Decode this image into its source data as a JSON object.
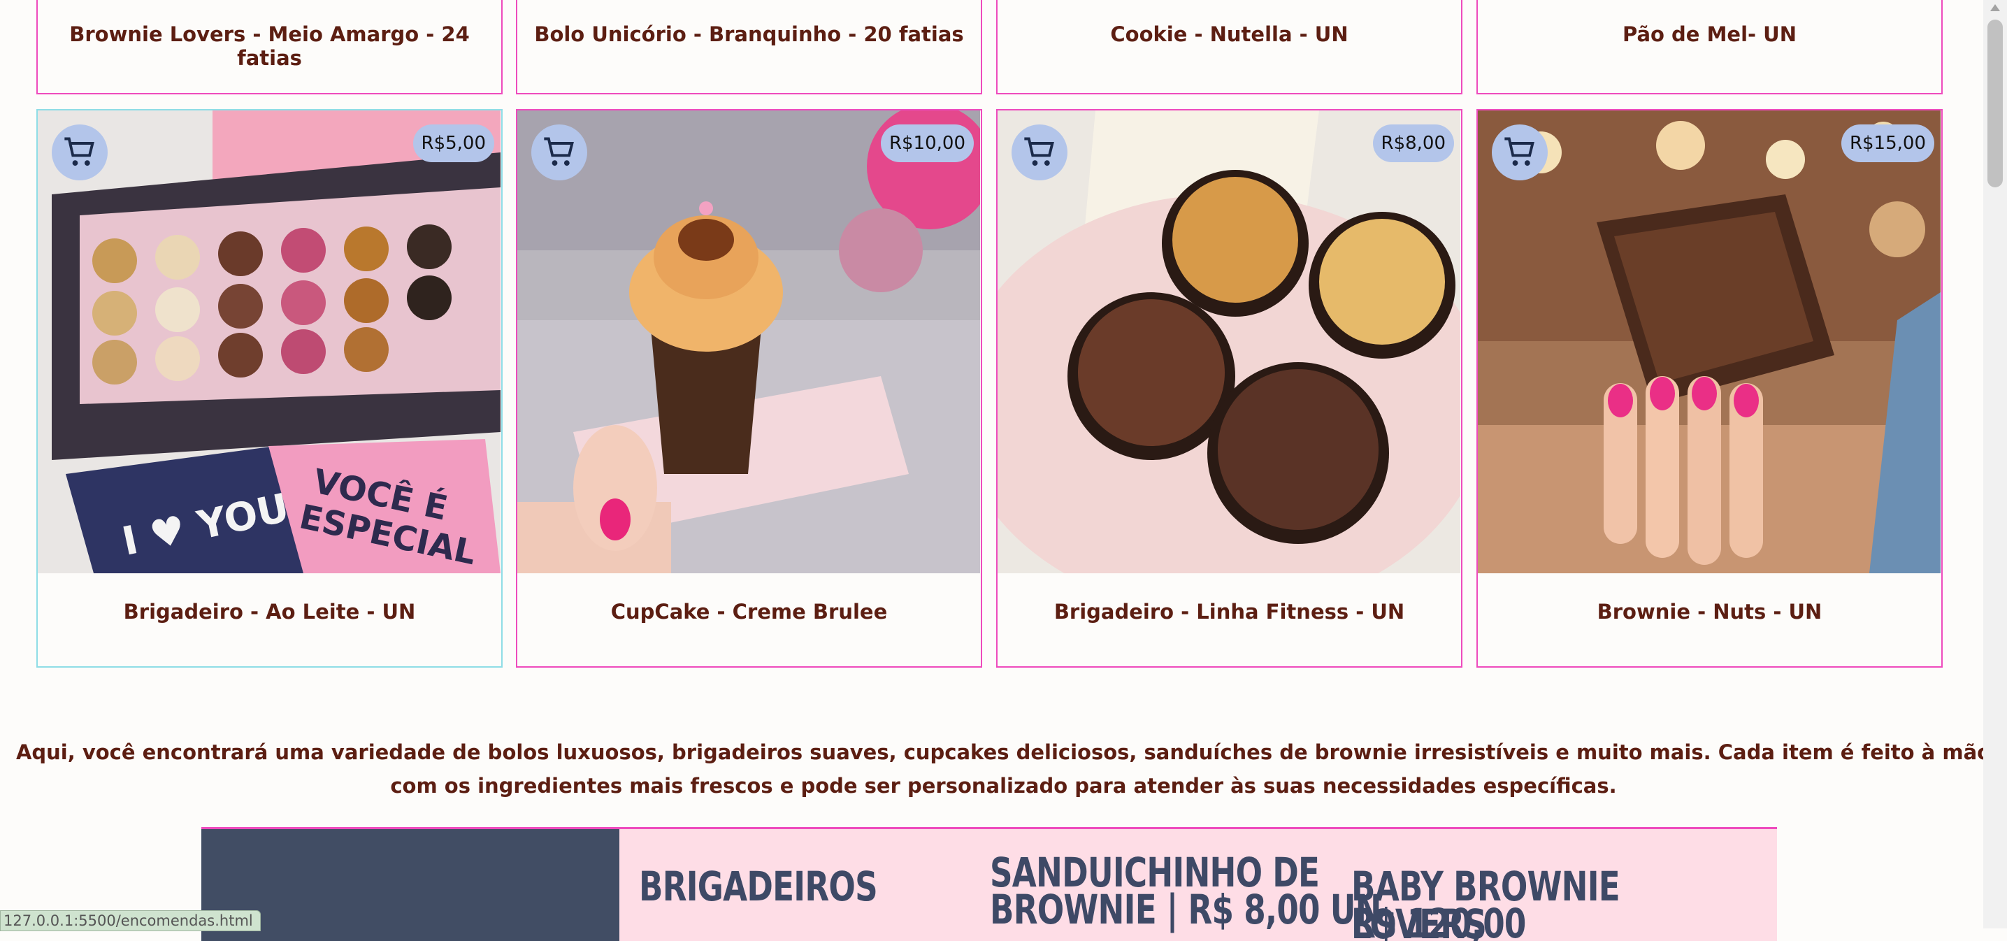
{
  "top_row": [
    {
      "name": "Brownie Lovers - Meio Amargo - 24 fatias"
    },
    {
      "name": "Bolo Unicório - Branquinho - 20 fatias"
    },
    {
      "name": "Cookie - Nutella - UN"
    },
    {
      "name": "Pão de Mel- UN"
    }
  ],
  "products": [
    {
      "name": "Brigadeiro - Ao Leite - UN",
      "price": "R$5,00",
      "cart_icon": "cart-icon"
    },
    {
      "name": "CupCake - Creme Brulee",
      "price": "R$10,00",
      "cart_icon": "cart-icon"
    },
    {
      "name": "Brigadeiro - Linha Fitness - UN",
      "price": "R$8,00",
      "cart_icon": "cart-icon"
    },
    {
      "name": "Brownie - Nuts - UN",
      "price": "R$15,00",
      "cart_icon": "cart-icon"
    }
  ],
  "description": "Aqui, você encontrará uma variedade de bolos luxuosos, brigadeiros suaves, cupcakes deliciosos, sanduíches de brownie irresistíveis e muito mais. Cada item é feito à mão com os ingredientes mais frescos e pode ser personalizado para atender às suas necessidades específicas.",
  "banner": {
    "categories": [
      "BRIGADEIROS",
      "SANDUICHINHO DE",
      "BROWNIE | R$ 8,00 UN",
      "BABY BROWNIE LOVERS",
      "R$ 120,00"
    ]
  },
  "status_bar": "127.0.0.1:5500/encomendas.html",
  "colors": {
    "accent_border": "#ee4bbd",
    "text": "#5c1e12",
    "badge": "#b3c5ea",
    "banner_bg": "#fedde6",
    "banner_dark": "#414d64"
  }
}
